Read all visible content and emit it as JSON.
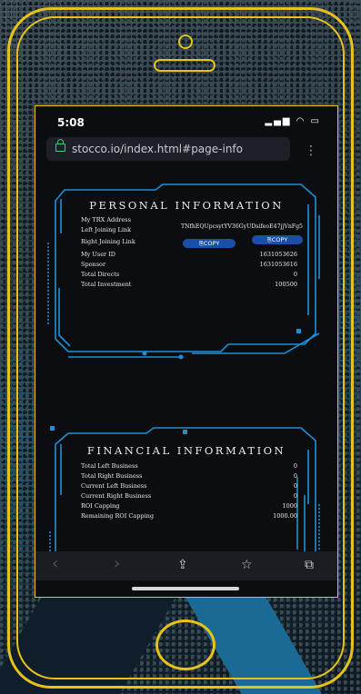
{
  "status": {
    "time": "5:08",
    "icons": "▂▄▆ ◠ ▭"
  },
  "browser": {
    "url": "stocco.io/index.html#page-info",
    "menu": "⋮"
  },
  "personal": {
    "title": "PERSONAL INFORMATION",
    "rows": [
      {
        "label": "My TRX Address",
        "value": ""
      },
      {
        "label": "Left Joining Link",
        "value": "TNfhEQUpcsytYV36GyUDsifeoE47jjVnFg5"
      },
      {
        "label": "Right Joining Link",
        "value": ""
      },
      {
        "label": "My User ID",
        "value": "1631053626"
      },
      {
        "label": "Sponsor",
        "value": "1631053616"
      },
      {
        "label": "Total Directs",
        "value": "0"
      },
      {
        "label": "Total Investment",
        "value": "100500"
      }
    ],
    "copy_left": "⎘COPY",
    "copy_right": "⎘COPY"
  },
  "financial": {
    "title": "FINANCIAL INFORMATION",
    "rows": [
      {
        "label": "Total Left Business",
        "value": "0"
      },
      {
        "label": "Total Right Business",
        "value": "0"
      },
      {
        "label": "Current Left Business",
        "value": "0"
      },
      {
        "label": "Current Right Business",
        "value": "0"
      },
      {
        "label": "ROI Capping",
        "value": "1000"
      },
      {
        "label": "Remaining ROI Capping",
        "value": "1000.00"
      }
    ]
  },
  "toolbar": {
    "back": "‹",
    "forward": "›",
    "share": "⇪",
    "bookmark": "☆",
    "tabs": "⧉"
  },
  "colors": {
    "accent": "#1e8fd6",
    "frame": "#e8c21a",
    "copy_button": "#1a4fa8"
  }
}
